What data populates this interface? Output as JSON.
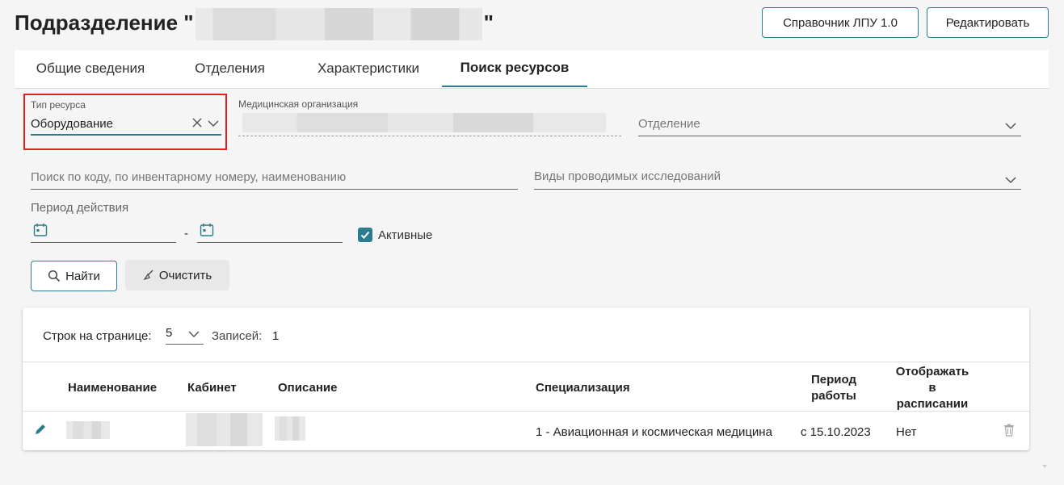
{
  "header": {
    "title": "Подразделение \"",
    "title_end": "\"",
    "btn_directory": "Справочник ЛПУ 1.0",
    "btn_edit": "Редактировать"
  },
  "tabs": [
    {
      "label": "Общие сведения"
    },
    {
      "label": "Отделения"
    },
    {
      "label": "Характеристики"
    },
    {
      "label": "Поиск ресурсов"
    }
  ],
  "filters": {
    "resource_type_label": "Тип ресурса",
    "resource_type_value": "Оборудование",
    "med_org_label": "Медицинская организация",
    "department_placeholder": "Отделение",
    "search_placeholder": "Поиск по коду, по инвентарному номеру, наименованию",
    "research_types_placeholder": "Виды проводимых исследований",
    "period_label": "Период действия",
    "period_separator": "-",
    "active_label": "Активные"
  },
  "actions": {
    "find": "Найти",
    "clear": "Очистить"
  },
  "table": {
    "rows_per_page_label": "Строк на странице:",
    "rows_per_page_value": "5",
    "records_label": "Записей:",
    "records_count": "1",
    "columns": {
      "name": "Наименование",
      "cabinet": "Кабинет",
      "description": "Описание",
      "specialization": "Специализация",
      "period": "Период работы",
      "show_in_schedule": "Отображать в расписании"
    },
    "rows": [
      {
        "specialization": "1 - Авиационная и космическая медицина",
        "period": "с 15.10.2023",
        "show_in_schedule": "Нет"
      }
    ]
  },
  "colors": {
    "accent": "#2a7d8f",
    "highlight": "#e02020"
  }
}
